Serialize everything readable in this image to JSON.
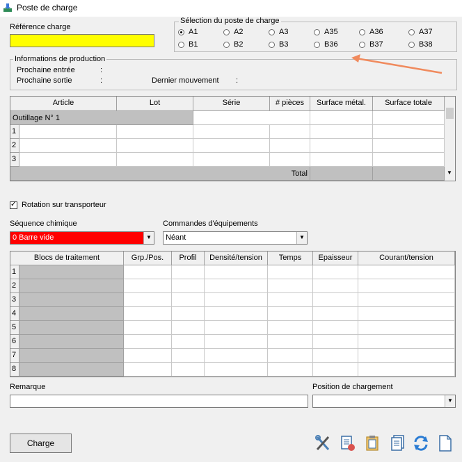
{
  "window": {
    "title": "Poste de charge"
  },
  "reference": {
    "label": "Référence charge",
    "value": ""
  },
  "selection": {
    "legend": "Sélection du poste de charge",
    "row1": [
      "A1",
      "A2",
      "A3",
      "A35",
      "A36",
      "A37"
    ],
    "row2": [
      "B1",
      "B2",
      "B3",
      "B36",
      "B37",
      "B38"
    ],
    "selected": "A1"
  },
  "production": {
    "legend": "Informations de production",
    "next_entry_label": "Prochaine entrée",
    "next_exit_label": "Prochaine sortie",
    "last_move_label": "Dernier mouvement",
    "sep": ":"
  },
  "articles_table": {
    "columns": [
      "Article",
      "Lot",
      "Série",
      "# pièces",
      "Surface métal.",
      "Surface totale"
    ],
    "group_label": "Outillage N° 1",
    "row_numbers": [
      "1",
      "2",
      "3"
    ],
    "total_label": "Total"
  },
  "rotation": {
    "label": "Rotation sur transporteur",
    "checked": true
  },
  "sequence": {
    "label": "Séquence chimique",
    "value": "0 Barre vide",
    "color": "#ff0000"
  },
  "equipment": {
    "label": "Commandes d'équipements",
    "value": "Néant"
  },
  "blocks_table": {
    "columns": [
      "Blocs de traitement",
      "Grp./Pos.",
      "Profil",
      "Densité/tension",
      "Temps",
      "Epaisseur",
      "Courant/tension"
    ],
    "row_numbers": [
      "1",
      "2",
      "3",
      "4",
      "5",
      "6",
      "7",
      "8"
    ]
  },
  "remark": {
    "label": "Remarque",
    "value": ""
  },
  "load_position": {
    "label": "Position de chargement",
    "value": ""
  },
  "charge_button": {
    "label": "Charge"
  },
  "colors": {
    "reference_bg": "#ffff00",
    "annotation_arrow": "#f08a5d"
  }
}
